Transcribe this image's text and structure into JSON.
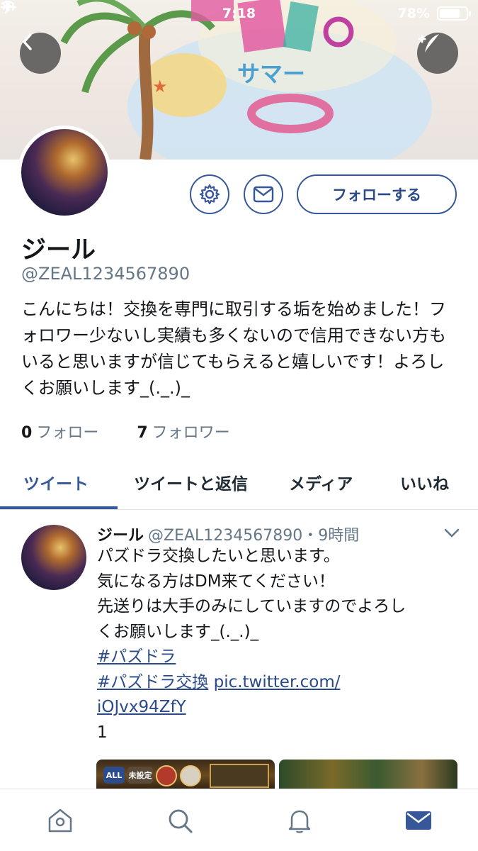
{
  "status_bar": {
    "time": "7:18",
    "battery_label": "78%",
    "battery_level": 0.78
  },
  "profile": {
    "display_name": "ジール",
    "handle": "@ZEAL1234567890",
    "bio": "こんにちは！交換を専門に取引する垢を始めました！フォロワー少ないし実績も多くないので信用できない方もいると思いますが信じてもらえると嬉しいです！よろしくお願いします_(._.)_",
    "follow_button": "フォローする",
    "following_count": "0",
    "following_label": "フォロー",
    "followers_count": "7",
    "followers_label": "フォロワー"
  },
  "tabs": [
    {
      "label": "ツイート",
      "active": true
    },
    {
      "label": "ツイートと返信",
      "active": false
    },
    {
      "label": "メディア",
      "active": false
    },
    {
      "label": "いいね",
      "active": false
    }
  ],
  "tweet": {
    "author": "ジール",
    "handle_time": "@ZEAL1234567890・9時間",
    "lines": [
      "パズドラ交換したいと思います。",
      "気になる方はDM来てください！",
      "先送りは大手のみにしていますのでよろし",
      "くお願いします_(._.)_"
    ],
    "hashtag_1": "#パズドラ",
    "hashtag_2": "#パズドラ交換",
    "link_part1": "pic.twitter.com/",
    "link_part2": "iOJvx94ZfY",
    "trailing": "1",
    "media_chips": [
      "ALL",
      "未設定"
    ]
  },
  "banner": {
    "banner_text": "サマー"
  },
  "icons": {
    "back": "chevron-left-icon",
    "compose": "compose-tweet-icon",
    "settings": "gear-icon",
    "message": "envelope-icon",
    "home": "home-icon",
    "search": "search-icon",
    "notifications": "bell-icon",
    "messages": "mail-icon"
  },
  "colors": {
    "accent": "#365899",
    "text": "#14171a",
    "muted": "#657786"
  }
}
